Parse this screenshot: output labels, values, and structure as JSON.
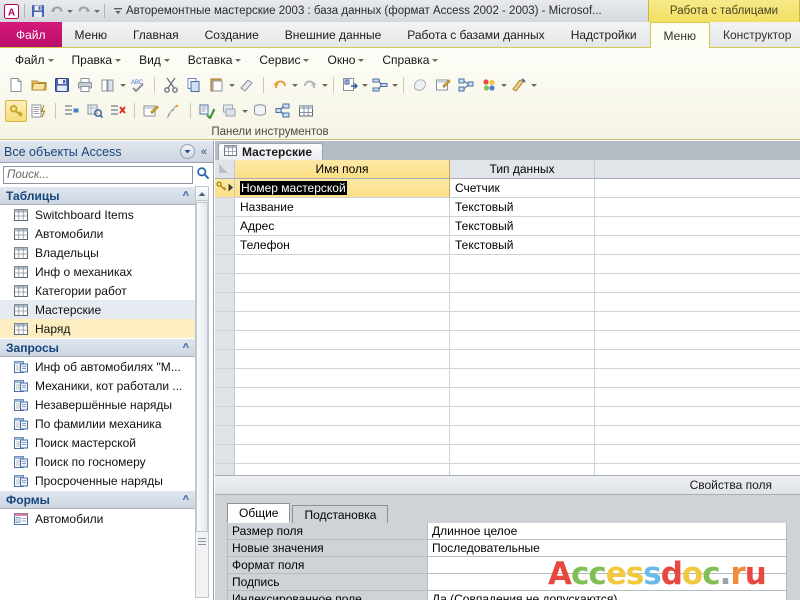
{
  "window": {
    "title": "Авторемонтные мастерские 2003 : база данных (формат Access 2002 - 2003)  -  Microsof...",
    "contextual_tab_group": "Работа с таблицами",
    "quick_access": [
      {
        "name": "access-logo-icon",
        "label": "A"
      },
      {
        "name": "save-icon",
        "label": "Сохранить"
      },
      {
        "name": "undo-icon",
        "label": "Отменить"
      },
      {
        "name": "redo-icon",
        "label": "Вернуть"
      },
      {
        "name": "customize-qat-icon",
        "label": "Настройка панели быстрого доступа"
      }
    ]
  },
  "ribbon": {
    "file_tab": "Файл",
    "tabs": [
      {
        "label": "Меню",
        "active": false
      },
      {
        "label": "Главная",
        "active": false
      },
      {
        "label": "Создание",
        "active": false
      },
      {
        "label": "Внешние данные",
        "active": false
      },
      {
        "label": "Работа с базами данных",
        "active": false
      },
      {
        "label": "Надстройки",
        "active": false
      }
    ],
    "contextual_tabs": [
      {
        "label": "Меню",
        "active": true
      },
      {
        "label": "Конструктор",
        "active": false
      }
    ],
    "group_caption": "Панели инструментов",
    "menu_items": [
      {
        "label": "Файл"
      },
      {
        "label": "Правка"
      },
      {
        "label": "Вид"
      },
      {
        "label": "Вставка"
      },
      {
        "label": "Сервис"
      },
      {
        "label": "Окно"
      },
      {
        "label": "Справка"
      }
    ],
    "toolbar_row1": [
      {
        "name": "new-icon"
      },
      {
        "name": "open-icon"
      },
      {
        "name": "save-icon"
      },
      {
        "name": "print-icon"
      },
      {
        "name": "print-preview-icon"
      },
      {
        "name": "spelling-icon"
      },
      {
        "name": "cut-icon"
      },
      {
        "name": "copy-icon"
      },
      {
        "name": "paste-icon"
      },
      {
        "name": "format-painter-icon"
      },
      {
        "name": "undo-icon"
      },
      {
        "name": "redo-icon"
      },
      {
        "name": "office-links-icon"
      },
      {
        "name": "analyze-icon"
      }
    ],
    "toolbar_row2": [
      {
        "name": "primary-key-icon",
        "active": true
      },
      {
        "name": "build-icon"
      },
      {
        "name": "insert-rows-icon"
      },
      {
        "name": "test-validation-icon"
      },
      {
        "name": "delete-rows-icon"
      },
      {
        "name": "properties-icon"
      },
      {
        "name": "indexes-icon"
      },
      {
        "name": "relationships-icon"
      },
      {
        "name": "object-dependencies-icon"
      },
      {
        "name": "new-object-icon"
      },
      {
        "name": "database-window-icon"
      },
      {
        "name": "table-icon"
      }
    ]
  },
  "nav_pane": {
    "title": "Все объекты Access",
    "dropdown_icon": "chevron-down-icon",
    "collapse_icon": "double-chevron-left-icon",
    "search_placeholder": "Поиск...",
    "search_value": "",
    "search_icon": "search-icon",
    "groups": [
      {
        "name": "Таблицы",
        "icon": "table-icon",
        "items": [
          {
            "label": "Switchboard Items",
            "state": "normal"
          },
          {
            "label": "Автомобили",
            "state": "normal"
          },
          {
            "label": "Владельцы",
            "state": "normal"
          },
          {
            "label": "Инф о механиках",
            "state": "normal"
          },
          {
            "label": "Категории работ",
            "state": "normal"
          },
          {
            "label": "Мастерские",
            "state": "highlight"
          },
          {
            "label": "Наряд",
            "state": "selected"
          }
        ]
      },
      {
        "name": "Запросы",
        "icon": "query-icon",
        "items": [
          {
            "label": "Инф об автомобилях \"М...",
            "state": "normal"
          },
          {
            "label": "Механики, кот работали ...",
            "state": "normal"
          },
          {
            "label": "Незавершённые наряды",
            "state": "normal"
          },
          {
            "label": "По фамилии механика",
            "state": "normal"
          },
          {
            "label": "Поиск мастерской",
            "state": "normal"
          },
          {
            "label": "Поиск по госномеру",
            "state": "normal"
          },
          {
            "label": "Просроченные наряды",
            "state": "normal"
          }
        ]
      },
      {
        "name": "Формы",
        "icon": "form-icon",
        "items": [
          {
            "label": "Автомобили",
            "state": "normal"
          }
        ]
      }
    ]
  },
  "document": {
    "tab_label": "Мастерские",
    "tab_icon": "table-icon",
    "grid": {
      "headers": [
        "Имя поля",
        "Тип данных",
        ""
      ],
      "rows": [
        {
          "primary_key": true,
          "field_name": "Номер мастерской",
          "data_type": "Счетчик",
          "description": "",
          "selected": true
        },
        {
          "primary_key": false,
          "field_name": "Название",
          "data_type": "Текстовый",
          "description": "",
          "selected": false
        },
        {
          "primary_key": false,
          "field_name": "Адрес",
          "data_type": "Текстовый",
          "description": "",
          "selected": false
        },
        {
          "primary_key": false,
          "field_name": "Телефон",
          "data_type": "Текстовый",
          "description": "",
          "selected": false
        }
      ],
      "empty_rows": 12
    },
    "properties_bar_label": "Свойства поля",
    "properties": {
      "tabs": [
        {
          "label": "Общие",
          "active": true
        },
        {
          "label": "Подстановка",
          "active": false
        }
      ],
      "rows": [
        {
          "key": "Размер поля",
          "value": "Длинное целое"
        },
        {
          "key": "Новые значения",
          "value": "Последовательные"
        },
        {
          "key": "Формат поля",
          "value": ""
        },
        {
          "key": "Подпись",
          "value": ""
        },
        {
          "key": "Индексированное поле",
          "value": "Да (Совпадения не допускаются)"
        }
      ]
    }
  },
  "watermark": {
    "text": "Accessdoc.ru",
    "letters": [
      {
        "ch": "A",
        "color": "#e8483f"
      },
      {
        "ch": "c",
        "color": "#7fbf55"
      },
      {
        "ch": "c",
        "color": "#7fbf55"
      },
      {
        "ch": "e",
        "color": "#f2c83c"
      },
      {
        "ch": "s",
        "color": "#f2c83c"
      },
      {
        "ch": "s",
        "color": "#6bb9e8"
      },
      {
        "ch": "d",
        "color": "#e8483f"
      },
      {
        "ch": "o",
        "color": "#f2c83c"
      },
      {
        "ch": "c",
        "color": "#7fbf55"
      },
      {
        "ch": ".",
        "color": "#9aa3ad"
      },
      {
        "ch": "r",
        "color": "#f08c3a"
      },
      {
        "ch": "u",
        "color": "#e8483f"
      }
    ]
  },
  "colors": {
    "file_tab": "#d6187a",
    "contextual_yellow": "#f2df63",
    "nav_title_blue": "#16477c",
    "field_name_header": "#fbdf86"
  }
}
